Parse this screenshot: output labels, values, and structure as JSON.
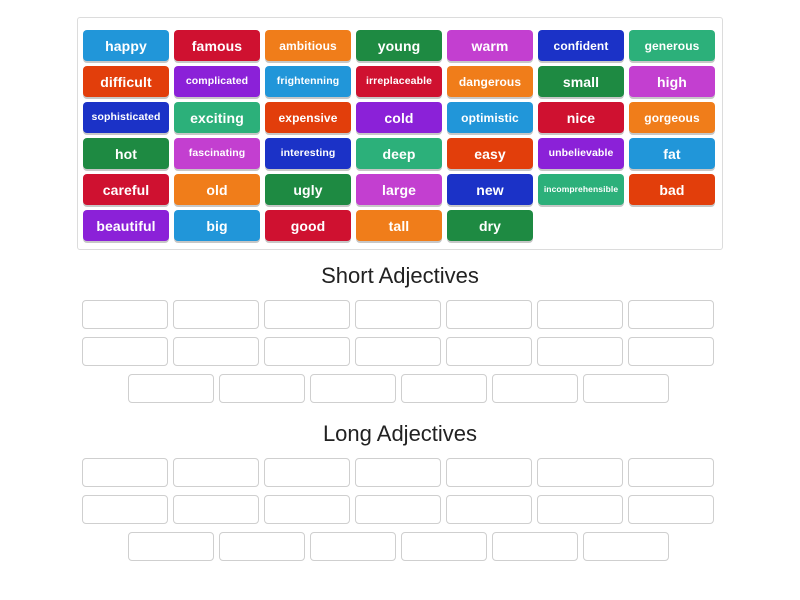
{
  "word_bank": {
    "name": "word-bank",
    "rows": [
      [
        {
          "label": "happy",
          "color": "#2196d9",
          "size": "normal"
        },
        {
          "label": "famous",
          "color": "#cf1130",
          "size": "normal"
        },
        {
          "label": "ambitious",
          "color": "#f07d1a",
          "size": "sm"
        },
        {
          "label": "young",
          "color": "#1e8a42",
          "size": "normal"
        },
        {
          "label": "warm",
          "color": "#c33fd0",
          "size": "normal"
        },
        {
          "label": "confident",
          "color": "#1b32c7",
          "size": "sm"
        },
        {
          "label": "generous",
          "color": "#2cb07a",
          "size": "sm"
        }
      ],
      [
        {
          "label": "difficult",
          "color": "#e23e0b",
          "size": "normal"
        },
        {
          "label": "complicated",
          "color": "#8b21d8",
          "size": "xs"
        },
        {
          "label": "frightenning",
          "color": "#2196d9",
          "size": "xs"
        },
        {
          "label": "irreplaceable",
          "color": "#cf1130",
          "size": "xs"
        },
        {
          "label": "dangerous",
          "color": "#f07d1a",
          "size": "sm"
        },
        {
          "label": "small",
          "color": "#1e8a42",
          "size": "normal"
        },
        {
          "label": "high",
          "color": "#c33fd0",
          "size": "normal"
        }
      ],
      [
        {
          "label": "sophisticated",
          "color": "#1b32c7",
          "size": "xs"
        },
        {
          "label": "exciting",
          "color": "#2cb07a",
          "size": "normal"
        },
        {
          "label": "expensive",
          "color": "#e23e0b",
          "size": "sm"
        },
        {
          "label": "cold",
          "color": "#8b21d8",
          "size": "normal"
        },
        {
          "label": "optimistic",
          "color": "#2196d9",
          "size": "sm"
        },
        {
          "label": "nice",
          "color": "#cf1130",
          "size": "normal"
        },
        {
          "label": "gorgeous",
          "color": "#f07d1a",
          "size": "sm"
        }
      ],
      [
        {
          "label": "hot",
          "color": "#1e8a42",
          "size": "normal"
        },
        {
          "label": "fascinating",
          "color": "#c33fd0",
          "size": "xs"
        },
        {
          "label": "interesting",
          "color": "#1b32c7",
          "size": "xs"
        },
        {
          "label": "deep",
          "color": "#2cb07a",
          "size": "normal"
        },
        {
          "label": "easy",
          "color": "#e23e0b",
          "size": "normal"
        },
        {
          "label": "unbelievable",
          "color": "#8b21d8",
          "size": "xs"
        },
        {
          "label": "fat",
          "color": "#2196d9",
          "size": "normal"
        }
      ],
      [
        {
          "label": "careful",
          "color": "#cf1130",
          "size": "normal"
        },
        {
          "label": "old",
          "color": "#f07d1a",
          "size": "normal"
        },
        {
          "label": "ugly",
          "color": "#1e8a42",
          "size": "normal"
        },
        {
          "label": "large",
          "color": "#c33fd0",
          "size": "normal"
        },
        {
          "label": "new",
          "color": "#1b32c7",
          "size": "normal"
        },
        {
          "label": "incomprehensible",
          "color": "#2cb07a",
          "size": "xxs"
        },
        {
          "label": "bad",
          "color": "#e23e0b",
          "size": "normal"
        }
      ],
      [
        {
          "label": "beautiful",
          "color": "#8b21d8",
          "size": "normal"
        },
        {
          "label": "big",
          "color": "#2196d9",
          "size": "normal"
        },
        {
          "label": "good",
          "color": "#cf1130",
          "size": "normal"
        },
        {
          "label": "tall",
          "color": "#f07d1a",
          "size": "normal"
        },
        {
          "label": "dry",
          "color": "#1e8a42",
          "size": "normal"
        }
      ]
    ]
  },
  "categories": [
    {
      "id": "short",
      "title": "Short Adjectives",
      "slot_rows": [
        7,
        7,
        6
      ],
      "indent_last_row": true
    },
    {
      "id": "long",
      "title": "Long Adjectives",
      "slot_rows": [
        7,
        7,
        6
      ],
      "indent_last_row": true
    }
  ],
  "colors": {
    "tile_blue": "#2196d9",
    "tile_crimson": "#cf1130",
    "tile_orange": "#f07d1a",
    "tile_green": "#1e8a42",
    "tile_orchid": "#c33fd0",
    "tile_navy": "#1b32c7",
    "tile_seafoam": "#2cb07a",
    "tile_orangered": "#e23e0b",
    "tile_purple": "#8b21d8",
    "slot_border": "#cfcfcf",
    "panel_border": "#dcdcdc",
    "title_text": "#222222",
    "page_background": "#ffffff"
  }
}
